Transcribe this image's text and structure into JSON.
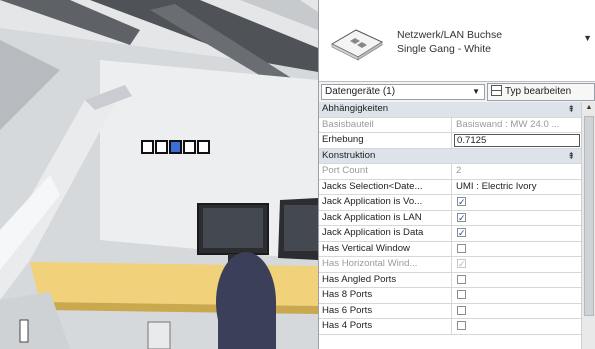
{
  "type_selector": {
    "family": "Netzwerk/LAN Buchse",
    "type": "Single Gang - White"
  },
  "filter": {
    "selected": "Datengeräte (1)",
    "edit_type_label": "Typ bearbeiten"
  },
  "groups": [
    {
      "name": "Abhängigkeiten",
      "toggle": "⇞",
      "rows": [
        {
          "name": "Basisbauteil",
          "value": "Basiswand : MW 24.0 ...",
          "kind": "text",
          "disabled": true
        },
        {
          "name": "Erhebung",
          "value": "0.7125",
          "kind": "edit",
          "disabled": false
        }
      ]
    },
    {
      "name": "Konstruktion",
      "toggle": "⇞",
      "rows": [
        {
          "name": "Port Count",
          "value": "2",
          "kind": "text",
          "disabled": true
        },
        {
          "name": "Jacks Selection<Date...",
          "value": "UMI : Electric Ivory",
          "kind": "text",
          "disabled": false
        },
        {
          "name": "Jack Application is Vo...",
          "checked": true,
          "kind": "check",
          "disabled": false
        },
        {
          "name": "Jack Application is LAN",
          "checked": true,
          "kind": "check",
          "disabled": false
        },
        {
          "name": "Jack Application is Data",
          "checked": true,
          "kind": "check",
          "disabled": false
        },
        {
          "name": "Has Vertical Window",
          "checked": false,
          "kind": "check",
          "disabled": false
        },
        {
          "name": "Has Horizontal Wind...",
          "checked": true,
          "kind": "check",
          "disabled": true
        },
        {
          "name": "Has Angled Ports",
          "checked": false,
          "kind": "check",
          "disabled": false
        },
        {
          "name": "Has 8 Ports",
          "checked": false,
          "kind": "check",
          "disabled": false
        },
        {
          "name": "Has 6 Ports",
          "checked": false,
          "kind": "check",
          "disabled": false
        },
        {
          "name": "Has 4 Ports",
          "checked": false,
          "kind": "check",
          "disabled": false
        }
      ]
    }
  ],
  "colors": {
    "group_header": "#dde3ea",
    "checkbox_mark": "#2a4b8d",
    "selected_port": "#3a6fd8",
    "desk": "#f1d27a"
  }
}
